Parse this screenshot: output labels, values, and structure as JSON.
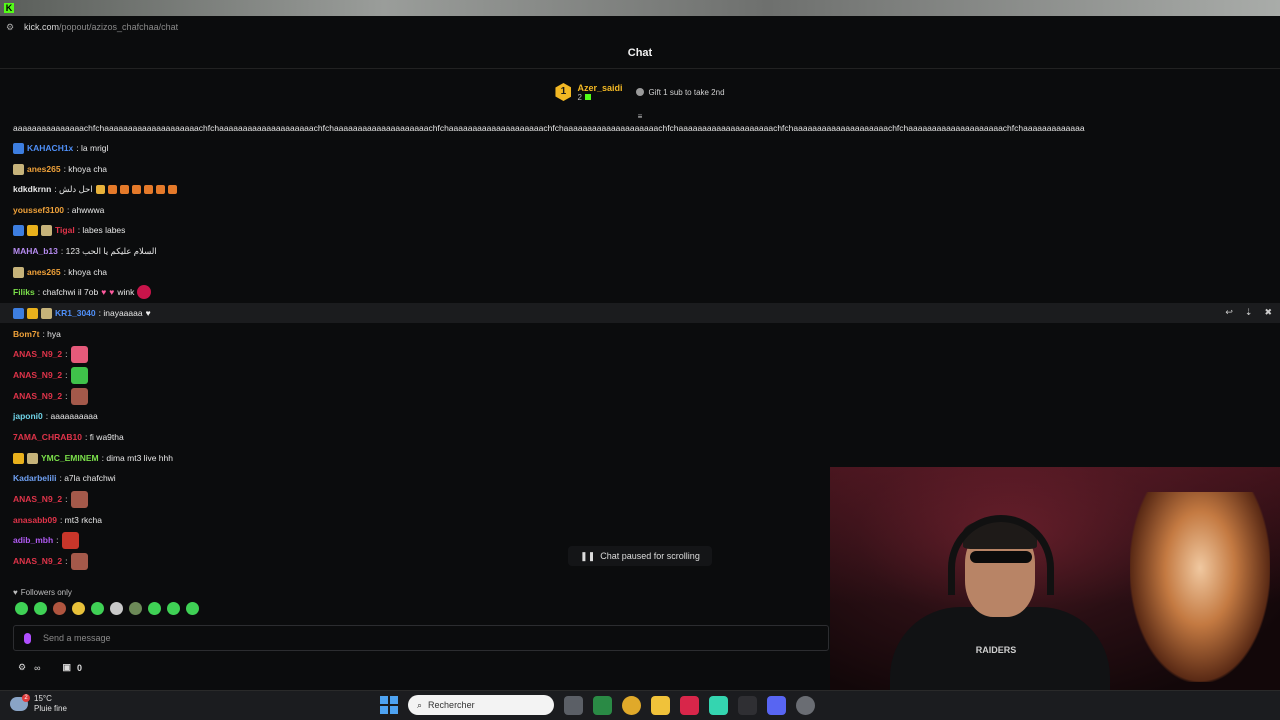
{
  "browser": {
    "url_host": "kick.com",
    "url_path": "/popout/azizos_chafchaa/chat"
  },
  "header": {
    "title": "Chat"
  },
  "pinned": {
    "rank": "1",
    "gifter_name": "Azer_saidi",
    "gifter_count": "2",
    "cta": "Gift 1 sub to take 2nd"
  },
  "chat": {
    "overflow_line": "aaaaaaaaaaaaaaachfchaaaaaaaaaaaaaaaaaaaachfchaaaaaaaaaaaaaaaaaaaachfchaaaaaaaaaaaaaaaaaaaachfchaaaaaaaaaaaaaaaaaaaachfchaaaaaaaaaaaaaaaaaaaachfchaaaaaaaaaaaaaaaaaaaachfchaaaaaaaaaaaaaaaaaaaachfchaaaaaaaaaaaaaaaaaaaachfchaaaaaaaaaaaaa",
    "messages": [
      {
        "user": "KAHACH1x",
        "color": "#4f8ff7",
        "text": ": la mrigl"
      },
      {
        "user": "anes265",
        "color": "#f0a23a",
        "text": ": khoya cha"
      },
      {
        "user": "kdkdkrnn",
        "color": "#e8e8e8",
        "text": ": احل دلش"
      },
      {
        "user": "youssef3100",
        "color": "#f0a23a",
        "text": ": ahwwwa"
      },
      {
        "user": "Tigal",
        "color": "#e0344a",
        "text": ": labes labes"
      },
      {
        "user": "MAHA_b13",
        "color": "#b78cf2",
        "text": ": السلام عليكم يا الحب 123"
      },
      {
        "user": "anes265",
        "color": "#f0a23a",
        "text": ": khoya cha"
      },
      {
        "user": "Filiks",
        "color": "#7be04a",
        "text": ": chafchwi il 7ob",
        "tail": "wink"
      },
      {
        "user": "KR1_3040",
        "color": "#4f8ff7",
        "text": ": inayaaaaa"
      },
      {
        "user": "Bom7t",
        "color": "#f0a23a",
        "text": ": hya"
      },
      {
        "user": "ANAS_N9_2",
        "color": "#e0344a",
        "text": ":"
      },
      {
        "user": "ANAS_N9_2",
        "color": "#e0344a",
        "text": ":"
      },
      {
        "user": "ANAS_N9_2",
        "color": "#e0344a",
        "text": ":"
      },
      {
        "user": "japoni0",
        "color": "#6fd3e6",
        "text": ": aaaaaaaaaa"
      },
      {
        "user": "7AMA_CHRAB10",
        "color": "#e0344a",
        "text": ": fi wa9tha"
      },
      {
        "user": "YMC_EMINEM",
        "color": "#7be04a",
        "text": ": dima mt3 live hhh"
      },
      {
        "user": "Kadarbelili",
        "color": "#6fa0f2",
        "text": ": a7la chafchwi"
      },
      {
        "user": "ANAS_N9_2",
        "color": "#e0344a",
        "text": ":"
      },
      {
        "user": "anasabb09",
        "color": "#e0344a",
        "text": ": mt3 rkcha"
      },
      {
        "user": "adib_mbh",
        "color": "#b05af2",
        "text": ":"
      },
      {
        "user": "ANAS_N9_2",
        "color": "#e0344a",
        "text": ":"
      }
    ],
    "paused_label": "Chat paused for scrolling"
  },
  "composer": {
    "followers_label": "Followers only",
    "placeholder": "Send a message",
    "points": "0"
  },
  "webcam": {
    "shirt_logo": "RAIDERS"
  },
  "taskbar": {
    "temp": "15°C",
    "weather": "Pluie fine",
    "weather_badge": "2",
    "search_placeholder": "Rechercher"
  },
  "colors": {
    "accent": "#53fc18",
    "background": "#0b0c0d"
  }
}
